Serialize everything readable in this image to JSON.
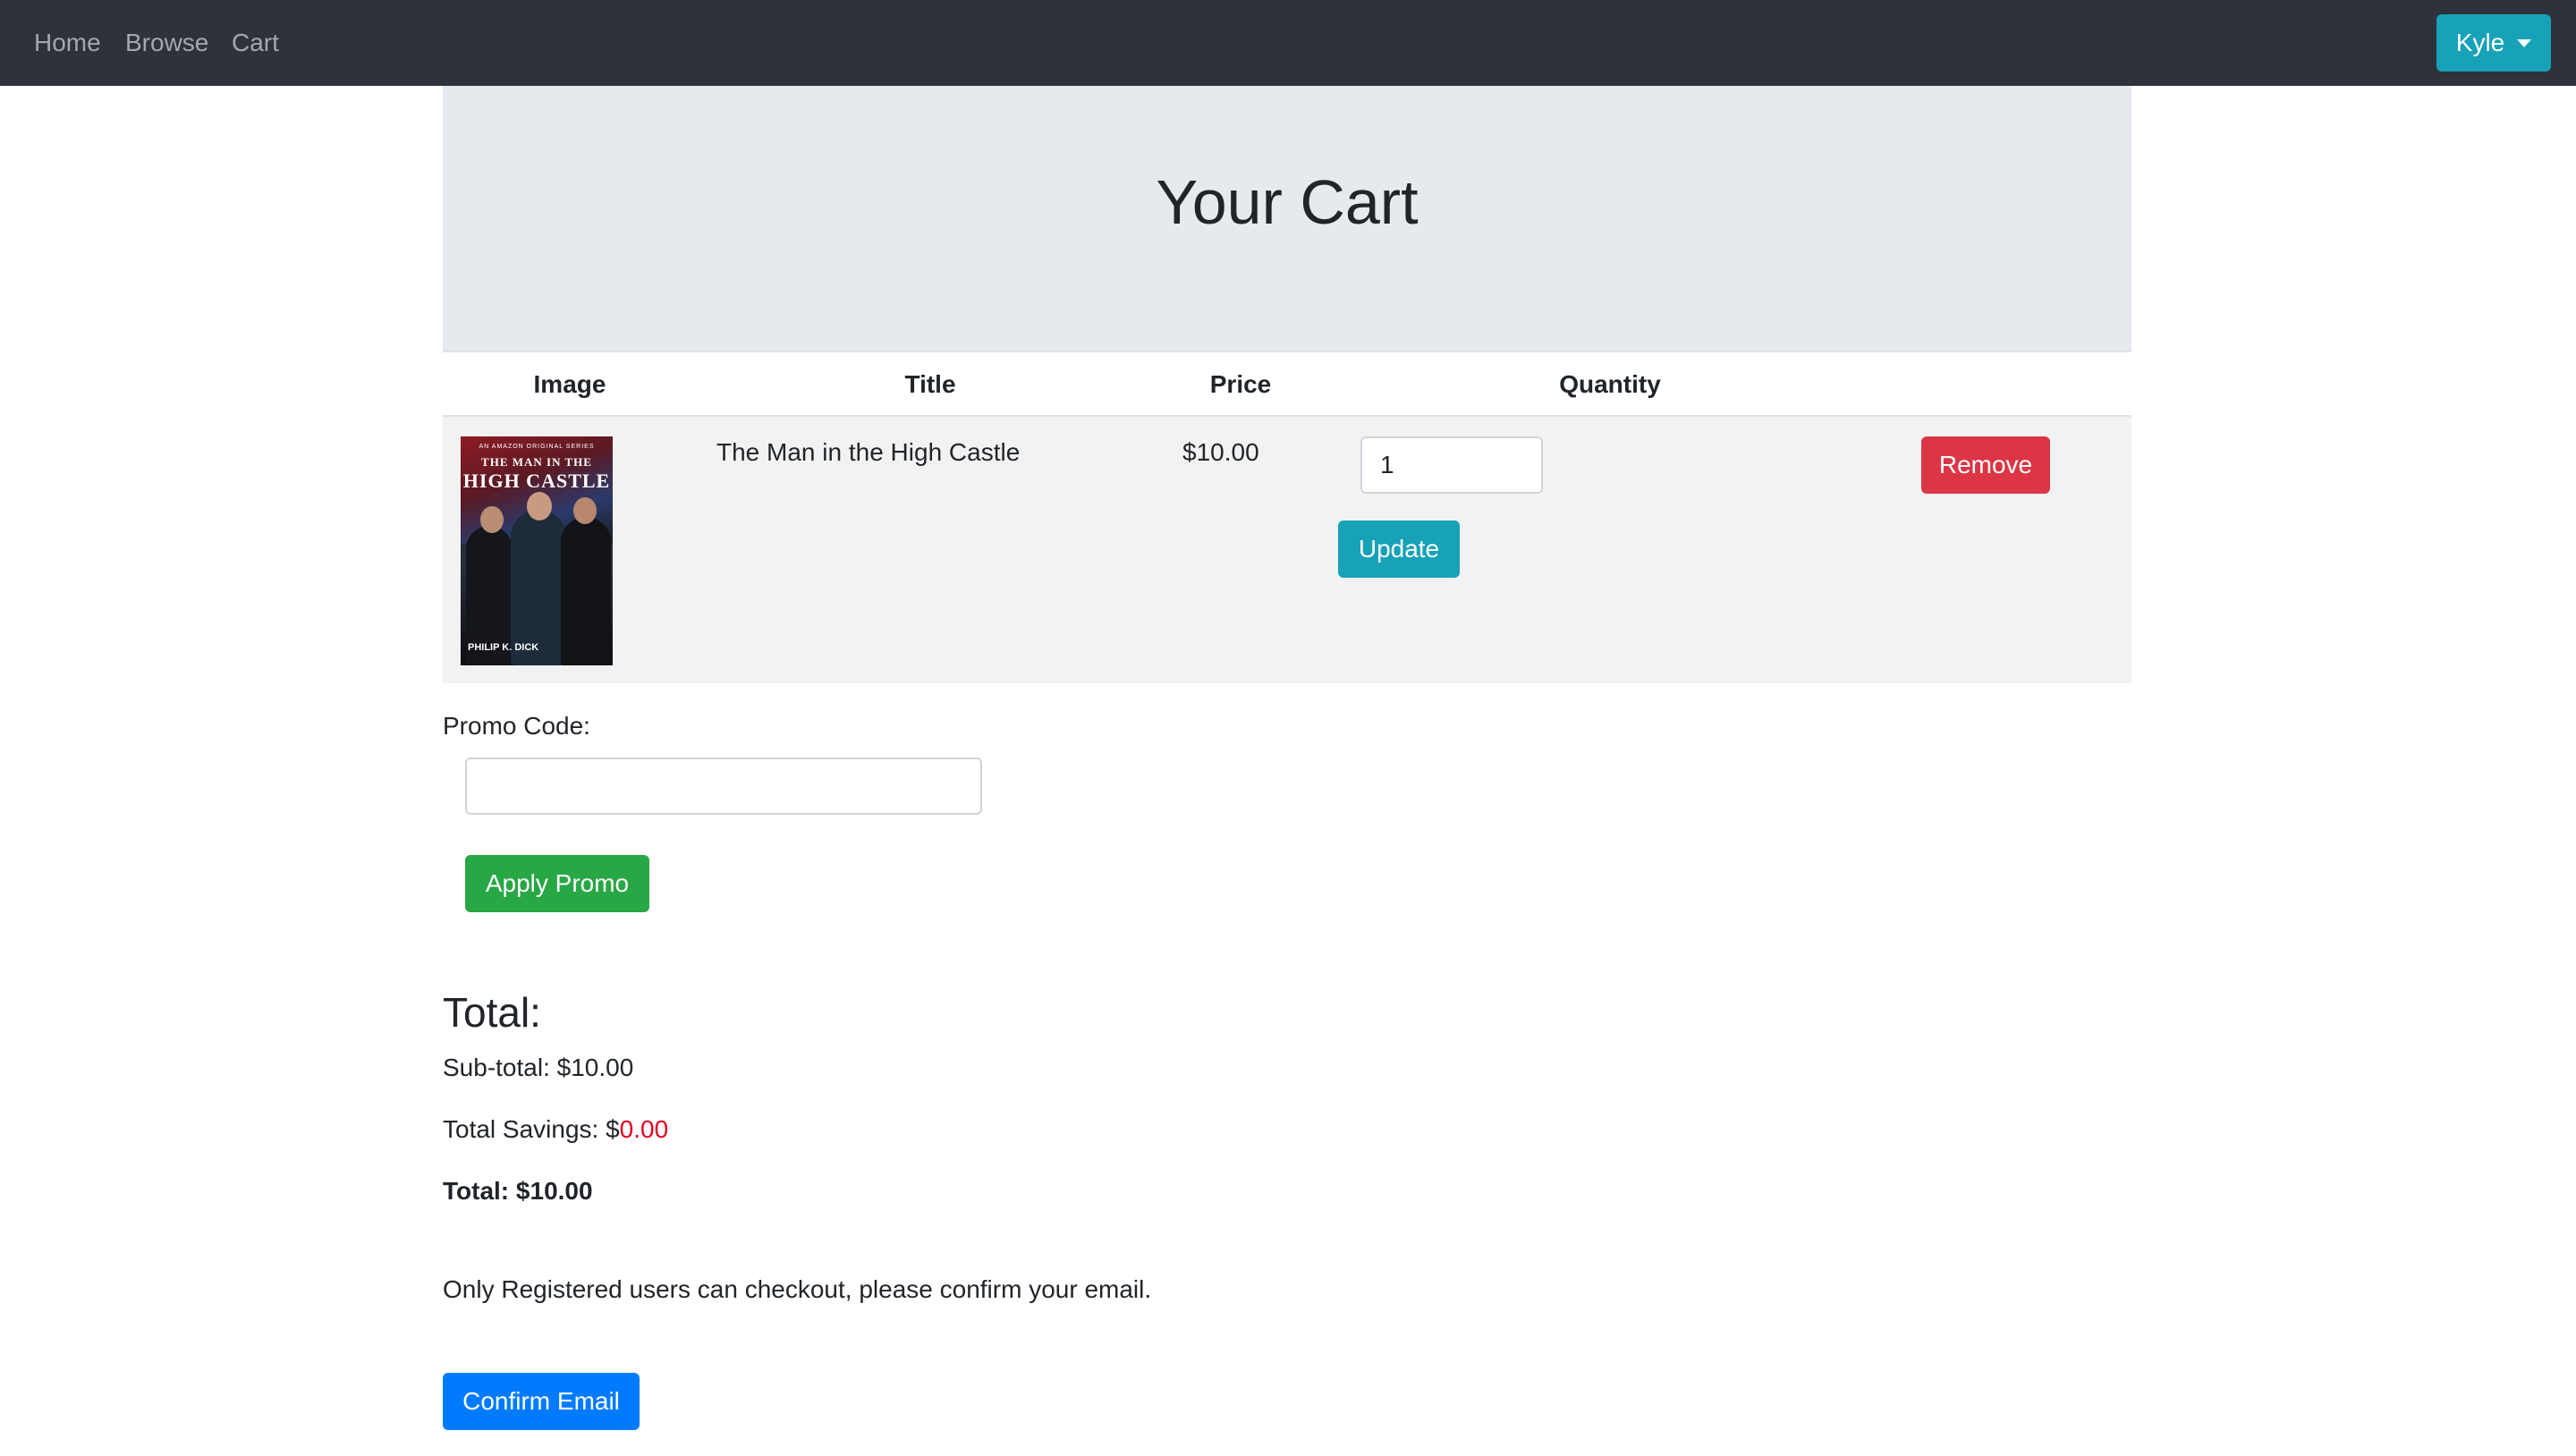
{
  "nav": {
    "links": [
      "Home",
      "Browse",
      "Cart"
    ],
    "user_label": "Kyle"
  },
  "page": {
    "title": "Your Cart"
  },
  "table": {
    "headers": [
      "Image",
      "Title",
      "Price",
      "Quantity"
    ],
    "rows": [
      {
        "title": "The Man in the High Castle",
        "price": "$10.00",
        "quantity": "1",
        "update_label": "Update",
        "remove_label": "Remove",
        "poster": {
          "top_text": "AN AMAZON ORIGINAL SERIES",
          "title_line1": "THE MAN IN THE",
          "title_line2": "HIGH CASTLE",
          "author": "PHILIP K. DICK"
        }
      }
    ]
  },
  "promo": {
    "label": "Promo Code:",
    "value": "",
    "apply_label": "Apply Promo"
  },
  "totals": {
    "heading": "Total:",
    "subtotal_label": "Sub-total: ",
    "subtotal_value": "$10.00",
    "savings_label": "Total Savings: $",
    "savings_value": "0.00",
    "total_label": "Total: ",
    "total_value": "$10.00"
  },
  "checkout": {
    "message": "Only Registered users can checkout, please confirm your email.",
    "confirm_label": "Confirm Email"
  },
  "colors": {
    "navbar": "#2e323b",
    "info": "#17a2b8",
    "danger": "#dc3545",
    "success": "#28a745",
    "primary": "#007bff",
    "savings": "#e6001f"
  }
}
